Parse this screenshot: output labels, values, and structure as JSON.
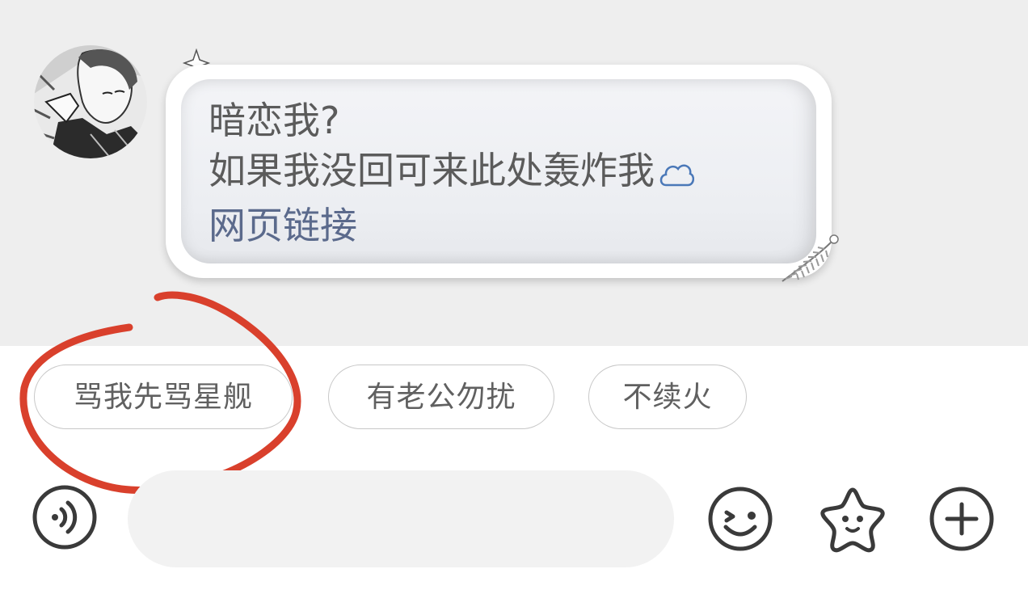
{
  "message": {
    "line1": "暗恋我?",
    "line2": "如果我没回可来此处轰炸我",
    "link": "网页链接",
    "bubble_icon": "cloud-icon"
  },
  "avatar": {
    "description_icon": "avatar"
  },
  "quick_replies": [
    {
      "label": "骂我先骂星舰"
    },
    {
      "label": "有老公勿扰"
    },
    {
      "label": "不续火"
    }
  ],
  "input": {
    "value": "",
    "placeholder": ""
  },
  "toolbar": {
    "voice_icon": "voice-icon",
    "emoji_icon": "smiley-icon",
    "sticker_icon": "star-sticker-icon",
    "plus_icon": "plus-icon"
  },
  "colors": {
    "chat_background": "#eeeeee",
    "annotation_red": "#d9402c",
    "link": "#5b6a8c",
    "text": "#5b5b5b",
    "chip_border": "#c8c8c8"
  }
}
